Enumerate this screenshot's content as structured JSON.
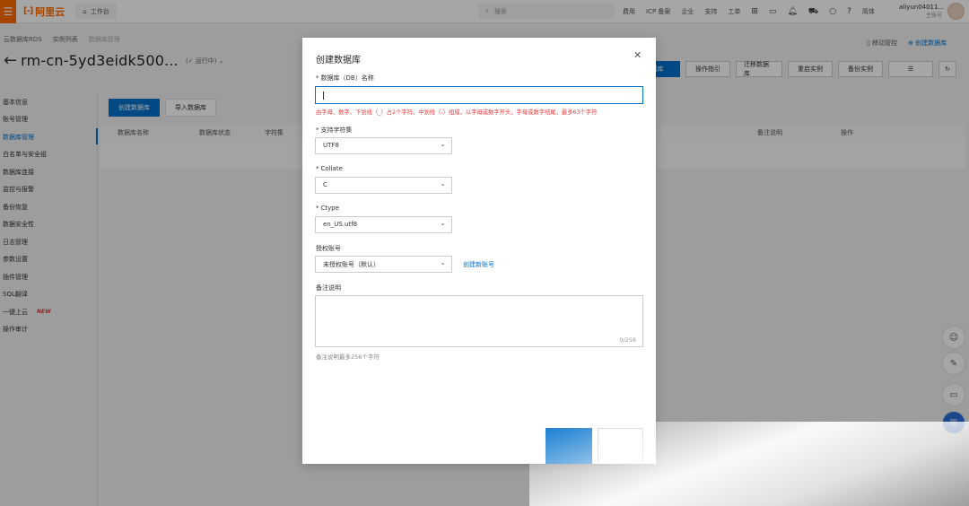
{
  "topbar": {
    "logo_text": "阿里云",
    "workbench": "工作台",
    "search_placeholder": "搜索",
    "links": [
      "费用",
      "ICP 备案",
      "企业",
      "支持",
      "工单"
    ],
    "lang": "简体",
    "account_name": "aliyun04011...",
    "account_sub": "主账号"
  },
  "breadcrumb": [
    "云数据库RDS",
    "实例列表",
    "数据库管理"
  ],
  "header": {
    "instance_title": "rm-cn-5yd3eidk500...",
    "status": "运行中",
    "mobile_ops": "移动管控",
    "create_db_link": "创建数据库",
    "buttons": [
      "数据库",
      "操作指引",
      "迁移数据库",
      "重启实例",
      "备份实例"
    ]
  },
  "sidebar": {
    "items": [
      "基本信息",
      "账号管理",
      "数据库管理",
      "白名单与安全组",
      "数据库连接",
      "监控与报警",
      "备份恢复",
      "数据安全性",
      "日志管理",
      "参数设置",
      "插件管理",
      "SQL翻译",
      "一键上云",
      "操作审计"
    ],
    "new_badge": "NEW"
  },
  "content": {
    "tabs": [
      "创建数据库",
      "导入数据库"
    ],
    "columns": [
      "数据库名称",
      "数据库状态",
      "字符集",
      "备注说明",
      "操作"
    ]
  },
  "modal": {
    "title": "创建数据库",
    "db_name_label": "数据库（DB）名称",
    "db_name_value": "",
    "db_name_error": "由字母、数字、下划线（_）占2个字符、中划线（-）组成，以字母或数字开头，字母或数字结尾，最多63个字符",
    "charset_label": "支持字符集",
    "charset_value": "UTF8",
    "collate_label": "Collate",
    "collate_value": "C",
    "ctype_label": "Ctype",
    "ctype_value": "en_US.utf8",
    "account_label": "授权账号",
    "account_value": "未授权账号（默认）",
    "create_account_link": "创建新账号",
    "remark_label": "备注说明",
    "remark_counter": "0/256",
    "remark_hint": "备注说明最多256个字符"
  },
  "colors": {
    "brand_orange": "#ff6a00",
    "primary_blue": "#0070cc",
    "error_red": "#e4393c"
  }
}
